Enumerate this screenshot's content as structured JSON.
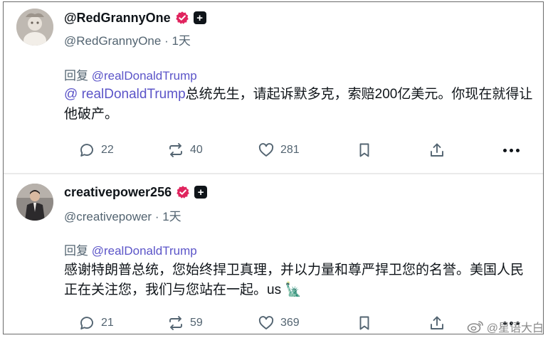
{
  "posts": [
    {
      "display_name": "@RedGrannyOne",
      "handle": "@RedGrannyOne",
      "time": "· 1天",
      "reply_prefix": "回复",
      "reply_to": "@realDonaldTrump",
      "body_mention": "@ realDonaldTrump",
      "body_text": "总统先生，请起诉默多克，索赔200亿美元。你现在就得让他破产。",
      "replies": "22",
      "reposts": "40",
      "likes": "281"
    },
    {
      "display_name": "creativepower256",
      "handle": "@creativepower",
      "time": "· 1天",
      "reply_prefix": "回复",
      "reply_to": "@realDonaldTrump",
      "body_text": "感谢特朗普总统，您始终捍卫真理，并以力量和尊严捍卫您的名誉。美国人民正在关注您，我们与您站在一起。us 🗽",
      "replies": "21",
      "reposts": "59",
      "likes": "369"
    }
  ],
  "watermark": "@星语大白",
  "colors": {
    "mention": "#5b54c8",
    "verified_badge": "#e0245e",
    "muted_text": "#536471"
  },
  "icons": [
    "reply-icon",
    "repost-icon",
    "like-icon",
    "bookmark-icon",
    "share-icon",
    "more-icon",
    "verified-icon",
    "plus-badge-icon",
    "weibo-icon"
  ]
}
